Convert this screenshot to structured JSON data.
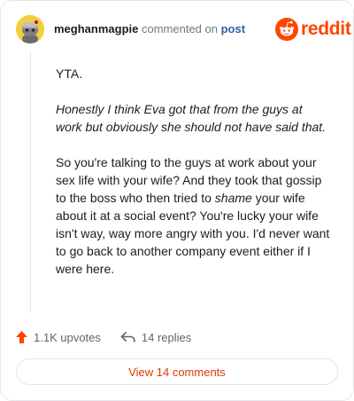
{
  "header": {
    "username": "meghanmagpie",
    "action_text": "commented on",
    "post_link": "post",
    "brand": "reddit"
  },
  "comment": {
    "line1": "YTA.",
    "italic_quote": "Honestly I think Eva got that from the guys at work but obviously she should not have said that.",
    "body_before_emphasis": "So you're talking to the guys at work about your sex life with your wife? And they took that gossip to the boss who then tried to ",
    "body_emphasis": "shame",
    "body_after_emphasis": " your wife about it at a social event? You're lucky your wife isn't way, way more angry with you. I'd never want to go back to another company event either if I were here."
  },
  "actions": {
    "upvotes": "1.1K upvotes",
    "replies": "14 replies"
  },
  "footer": {
    "view_comments": "View 14 comments"
  },
  "colors": {
    "accent": "#ff4500",
    "link": "#2f5f9e",
    "avatar_bg": "#f2cf3e"
  },
  "icons": {
    "upvote": "arrow-up-icon",
    "reply": "reply-arrow-icon",
    "brand": "reddit-alien-icon"
  }
}
